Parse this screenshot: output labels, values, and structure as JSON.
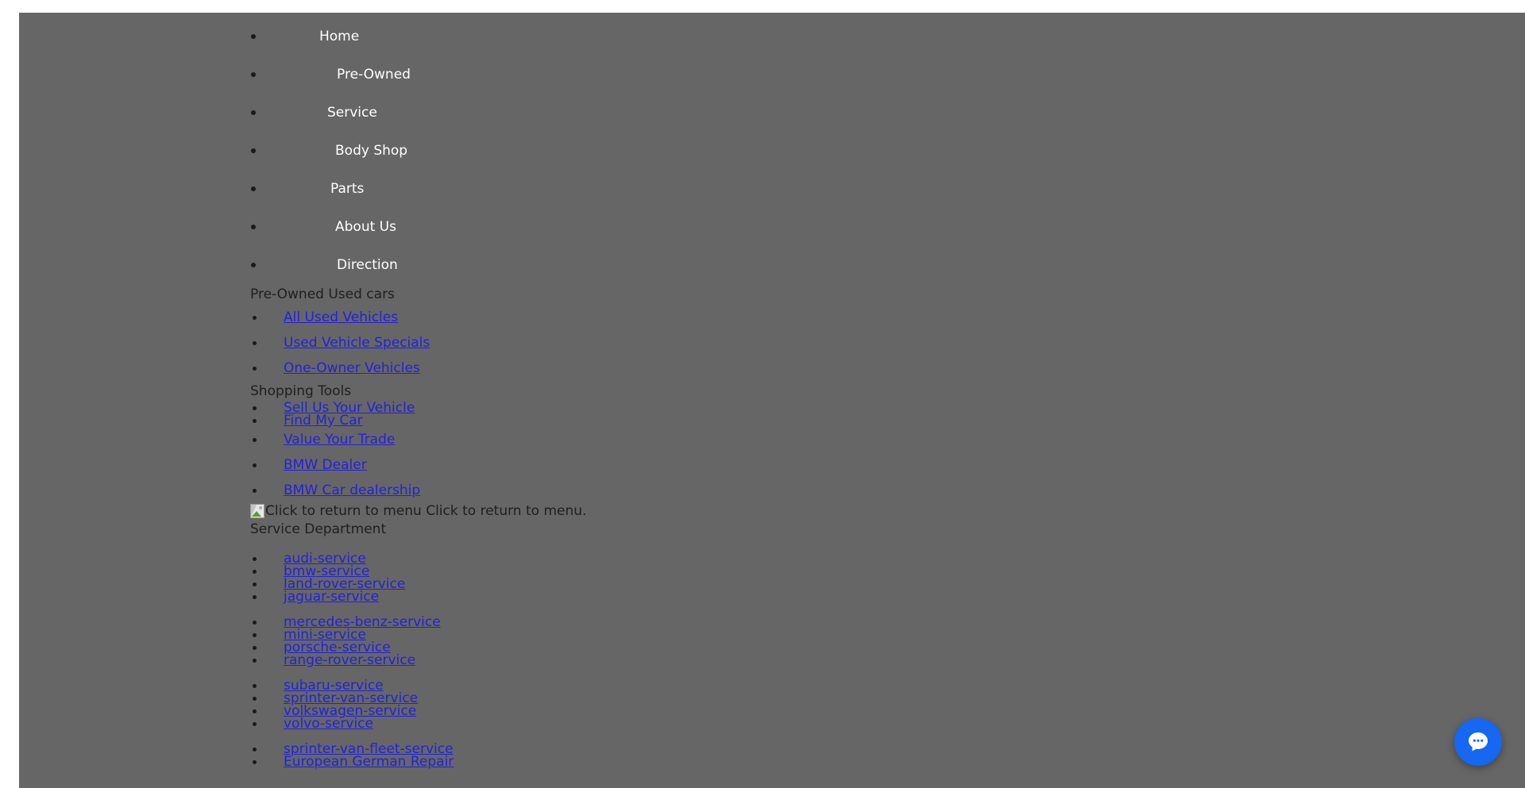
{
  "page": {
    "background_color": "#666666",
    "link_color": "#2222dd",
    "menu_text_color": "#ffffff",
    "heading_text_color": "#1f1f1f"
  },
  "main_menu": {
    "items": [
      {
        "label": "Home",
        "indent": 378
      },
      {
        "label": "Pre-Owned",
        "indent": 400
      },
      {
        "label": "Service",
        "indent": 388
      },
      {
        "label": "Body Shop",
        "indent": 398
      },
      {
        "label": "Parts",
        "indent": 392
      },
      {
        "label": "About Us",
        "indent": 398
      },
      {
        "label": "Direction",
        "indent": 400
      }
    ]
  },
  "pre_owned": {
    "heading": "Pre-Owned Used cars",
    "links": [
      "All Used Vehicles",
      "Used Vehicle Specials",
      "One-Owner Vehicles"
    ]
  },
  "shopping_tools": {
    "heading": "Shopping Tools",
    "links": [
      "Sell Us Your Vehicle",
      "Find My Car",
      "Value Your Trade",
      "BMW Dealer",
      "BMW Car dealership"
    ]
  },
  "return_to_menu": {
    "image_alt": "Click to return to menu",
    "caption": "Click to return to menu.",
    "icon": "broken-image-icon"
  },
  "service_department": {
    "heading": "Service Department",
    "groups": [
      [
        "audi-service",
        "bmw-service",
        "land-rover-service",
        "jaguar-service"
      ],
      [
        "mercedes-benz-service",
        "mini-service",
        "porsche-service",
        "range-rover-service"
      ],
      [
        "subaru-service",
        "sprinter-van-service",
        "volkswagen-service",
        "volvo-service"
      ],
      [
        "sprinter-van-fleet-service",
        "European German Repair"
      ]
    ]
  },
  "chat_widget": {
    "icon": "chat-bubble-icon",
    "color": "#1667f2"
  }
}
